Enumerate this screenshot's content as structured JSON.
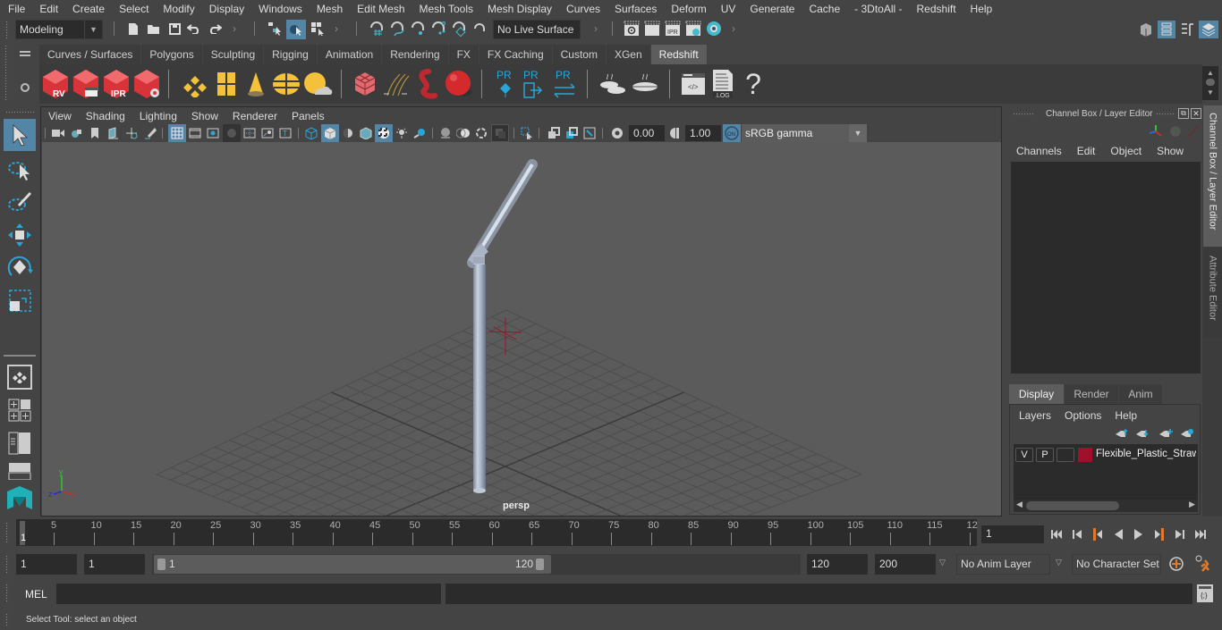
{
  "menubar": {
    "items": [
      "File",
      "Edit",
      "Create",
      "Select",
      "Modify",
      "Display",
      "Windows",
      "Mesh",
      "Edit Mesh",
      "Mesh Tools",
      "Mesh Display",
      "Curves",
      "Surfaces",
      "Deform",
      "UV",
      "Generate",
      "Cache",
      "- 3DtoAll -",
      "Redshift",
      "Help"
    ]
  },
  "statusline": {
    "workspace": "Modeling",
    "live_surface": "No Live Surface"
  },
  "shelf": {
    "tabs": [
      "Curves / Surfaces",
      "Polygons",
      "Sculpting",
      "Rigging",
      "Animation",
      "Rendering",
      "FX",
      "FX Caching",
      "Custom",
      "XGen",
      "Redshift"
    ],
    "active_tab": "Redshift",
    "icon_labels": {
      "rv": "RV",
      "ipr": "IPR",
      "pr": "PR",
      "log": ".LOG",
      "help": "?"
    }
  },
  "viewport": {
    "menu": [
      "View",
      "Shading",
      "Lighting",
      "Show",
      "Renderer",
      "Panels"
    ],
    "exposure": "0.00",
    "gamma": "1.00",
    "color_space": "sRGB gamma",
    "camera_label": "persp",
    "axis": {
      "x": "x",
      "y": "y",
      "z": "z"
    },
    "on_label": "ON"
  },
  "channel_box": {
    "title": "Channel Box / Layer Editor",
    "menu": [
      "Channels",
      "Edit",
      "Object",
      "Show"
    ]
  },
  "layer_editor": {
    "tabs": [
      "Display",
      "Render",
      "Anim"
    ],
    "active_tab": "Display",
    "menu": [
      "Layers",
      "Options",
      "Help"
    ],
    "layers": [
      {
        "visible": "V",
        "playback": "P",
        "color": "#a0102a",
        "name": "Flexible_Plastic_Straw_"
      }
    ]
  },
  "side_tabs": [
    "Channel Box / Layer Editor",
    "Attribute Editor"
  ],
  "timeline": {
    "ticks": [
      "5",
      "10",
      "15",
      "20",
      "25",
      "30",
      "35",
      "40",
      "45",
      "50",
      "55",
      "60",
      "65",
      "70",
      "75",
      "80",
      "85",
      "90",
      "95",
      "100",
      "105",
      "110",
      "115",
      "12"
    ],
    "current_frame_marker": "1",
    "current_frame": "1"
  },
  "range": {
    "start": "1",
    "playback_start": "1",
    "slider_start": "1",
    "slider_end": "120",
    "playback_end": "120",
    "end": "200",
    "anim_layer": "No Anim Layer",
    "character_set": "No Character Set"
  },
  "command": {
    "language": "MEL"
  },
  "help_line": {
    "text": "Select Tool: select an object"
  },
  "colors": {
    "accent": "#5285a6",
    "redshift_red": "#d9333a",
    "yellow": "#f3c13a",
    "cyan": "#27a6d8",
    "layer_color": "#a0102a"
  }
}
